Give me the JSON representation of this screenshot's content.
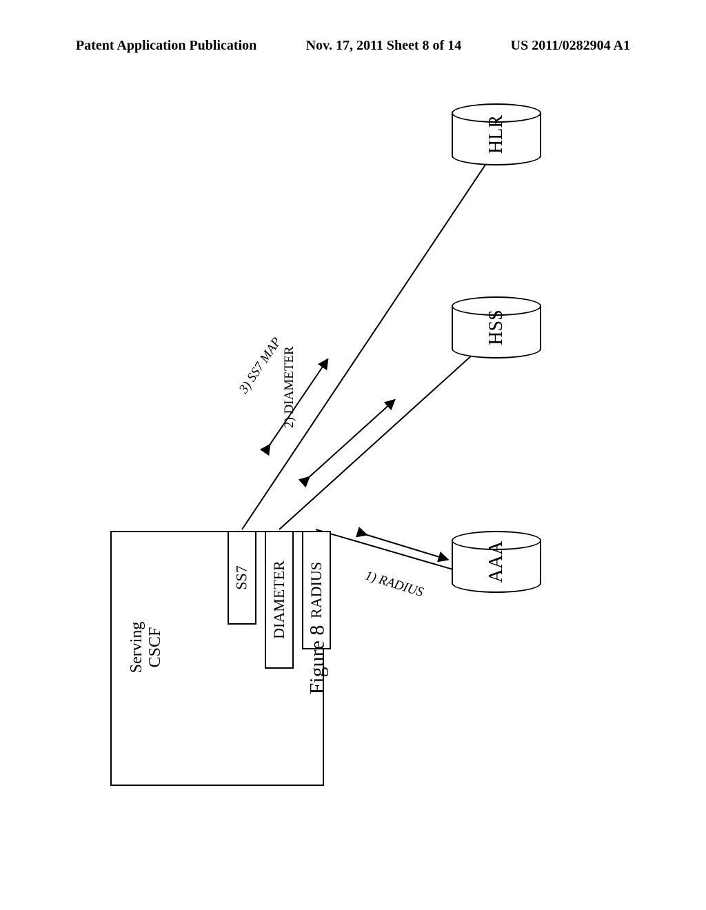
{
  "header": {
    "left": "Patent Application Publication",
    "center": "Nov. 17, 2011  Sheet 8 of 14",
    "right": "US 2011/0282904 A1"
  },
  "diagram": {
    "serving_box_label_line1": "Serving",
    "serving_box_label_line2": "CSCF",
    "stacks": {
      "ss7": "SS7",
      "diameter": "DIAMETER",
      "radius": "RADIUS"
    },
    "cylinders": {
      "hlr": "HLR",
      "hss": "HSS",
      "aaa": "AAA"
    },
    "links": {
      "ss7map": "3) SS7 MAP",
      "diameter": "2) DIAMETER",
      "radius": "1) RADIUS"
    },
    "caption": "Figure 8"
  }
}
